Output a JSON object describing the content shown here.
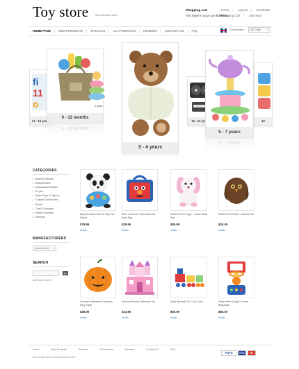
{
  "header": {
    "logo": "Toy store",
    "tagline": "the best online store",
    "cart_title": "Shopping cart",
    "cart_text": "You have in your cart",
    "cart_count": "0 items",
    "links_row1": [
      "Home",
      "Log out",
      "Newsletter"
    ],
    "links_row2": [
      "Shopping Cart",
      "Checkout"
    ]
  },
  "nav": {
    "items": [
      "HOME PAGE",
      "NEW PRODUCTS",
      "SPECIALS",
      "ALL PRODUCTS",
      "REVIEWS",
      "CONTACT US",
      "FAQ"
    ],
    "currency_label": "Currencies:",
    "currency_value": "US Dollar"
  },
  "slider": {
    "small_left": "12 - 14 years",
    "left": "0 - 12 months",
    "left_small_label": "3 years",
    "center": "3 - 4 years",
    "right_small": "12 - 14 years",
    "right": "5 - 7 years",
    "far_right": "12"
  },
  "sidebar": {
    "categories_title": "CATEGORIES",
    "categories": [
      "Board/Character",
      "Dolls/Stickers",
      "Dollhouses/Vehicles",
      "Ex-plot",
      "Action Toys & Figures",
      "Crayon/Construction",
      "Sports",
      "Craft & Activities",
      "Helpful Products",
      "Ethnicity"
    ],
    "manufacturers_title": "MANUFACTURERS",
    "manufacturers_select": "please select",
    "search_title": "SEARCH",
    "search_button": "go",
    "advanced_search": "advanced search"
  },
  "products": [
    {
      "name": "Baby Einstein Press & Play Pal - Panda",
      "price": "$79.99",
      "details": "details"
    },
    {
      "name": "Elmo Lunch Kit - Blue and Red Book Bag",
      "price": "$29.99",
      "details": "details"
    },
    {
      "name": "Webkinz Pet Puppy - Cream Bead Pup",
      "price": "$89.99",
      "details": "details"
    },
    {
      "name": "Webkinz Pet Plush - Gamed Owl",
      "price": "$28.49",
      "details": "details"
    },
    {
      "name": "Grandeur Halloween Pumpkin Ring Rattle",
      "price": "$49.99",
      "details": "details"
    },
    {
      "name": "Disney Princess Dollhouse Set",
      "price": "$34.99",
      "details": "details"
    },
    {
      "name": "Mack Musical Fun Choo Choo",
      "price": "$69.99",
      "details": "details"
    },
    {
      "name": "Fisher-Price Laugh N Learn Basketball",
      "price": "$89.00",
      "details": "details"
    }
  ],
  "footer": {
    "links": [
      "Home",
      "New Products",
      "Specials",
      "All Products",
      "Reviews",
      "Contact Us",
      "FAQ"
    ],
    "copyright": "Zen Cart(c) 2011. Powered by Zen Cart.",
    "payments": [
      "PayPal",
      "VISA",
      "MC"
    ]
  },
  "colors": {
    "link": "#3a86c8",
    "price": "#222222",
    "nav_active": "#000000"
  }
}
